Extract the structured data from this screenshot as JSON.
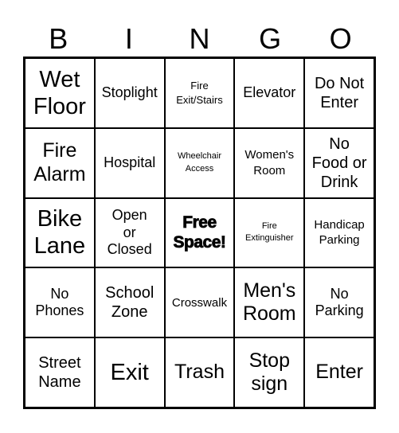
{
  "card": {
    "header": [
      "B",
      "I",
      "N",
      "G",
      "O"
    ],
    "rows": [
      [
        {
          "text": "Wet\nFloor",
          "size": "xl"
        },
        {
          "text": "Stoplight",
          "size": "ms"
        },
        {
          "text": "Fire\nExit/Stairs",
          "size": "xs"
        },
        {
          "text": "Elevator",
          "size": "ms"
        },
        {
          "text": "Do Not\nEnter",
          "size": "m"
        }
      ],
      [
        {
          "text": "Fire\nAlarm",
          "size": "l"
        },
        {
          "text": "Hospital",
          "size": "ms"
        },
        {
          "text": "Wheelchair\nAccess",
          "size": "xxs"
        },
        {
          "text": "Women's\nRoom",
          "size": "s"
        },
        {
          "text": "No\nFood or\nDrink",
          "size": "m"
        }
      ],
      [
        {
          "text": "Bike\nLane",
          "size": "xl"
        },
        {
          "text": "Open\nor\nClosed",
          "size": "ms"
        },
        {
          "text": "Free\nSpace!",
          "size": "free"
        },
        {
          "text": "Fire\nExtinguisher",
          "size": "xxs"
        },
        {
          "text": "Handicap\nParking",
          "size": "s"
        }
      ],
      [
        {
          "text": "No\nPhones",
          "size": "ms"
        },
        {
          "text": "School\nZone",
          "size": "m"
        },
        {
          "text": "Crosswalk",
          "size": "s"
        },
        {
          "text": "Men's\nRoom",
          "size": "l"
        },
        {
          "text": "No\nParking",
          "size": "ms"
        }
      ],
      [
        {
          "text": "Street\nName",
          "size": "m"
        },
        {
          "text": "Exit",
          "size": "xl"
        },
        {
          "text": "Trash",
          "size": "l"
        },
        {
          "text": "Stop\nsign",
          "size": "l"
        },
        {
          "text": "Enter",
          "size": "l"
        }
      ]
    ]
  }
}
